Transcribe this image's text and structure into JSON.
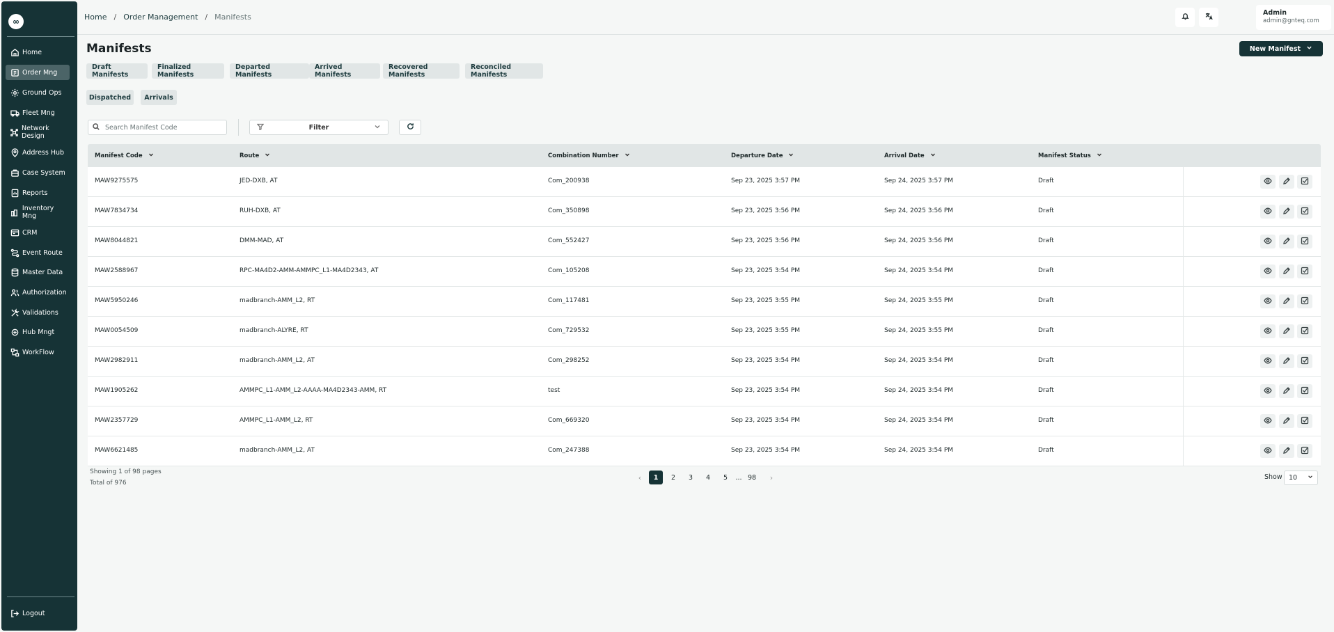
{
  "app": {
    "logo_glyph": "∞"
  },
  "sidebar": {
    "items": [
      {
        "label": "Home",
        "icon": "home-icon"
      },
      {
        "label": "Order Mng",
        "icon": "order-icon",
        "active": true
      },
      {
        "label": "Ground Ops",
        "icon": "ground-ops-icon"
      },
      {
        "label": "Fleet Mng",
        "icon": "truck-icon"
      },
      {
        "label": "Network Design",
        "icon": "network-icon"
      },
      {
        "label": "Address Hub",
        "icon": "location-icon"
      },
      {
        "label": "Case System",
        "icon": "case-icon"
      },
      {
        "label": "Reports",
        "icon": "reports-icon"
      },
      {
        "label": "Inventory Mng",
        "icon": "inventory-icon"
      },
      {
        "label": "CRM",
        "icon": "crm-icon"
      },
      {
        "label": "Event Route",
        "icon": "route-icon"
      },
      {
        "label": "Master Data",
        "icon": "database-icon"
      },
      {
        "label": "Authorization",
        "icon": "users-icon"
      },
      {
        "label": "Validations",
        "icon": "tools-icon"
      },
      {
        "label": "Hub Mngt",
        "icon": "hub-icon"
      },
      {
        "label": "WorkFlow",
        "icon": "workflow-icon"
      }
    ],
    "logout": "Logout"
  },
  "breadcrumb": {
    "home": "Home",
    "section": "Order Management",
    "current": "Manifests",
    "separator": "/"
  },
  "user": {
    "name": "Admin",
    "email": "admin@gnteq.com"
  },
  "page": {
    "title": "Manifests",
    "new_button": "New Manifest"
  },
  "tabs": [
    "Draft Manifests",
    "Finalized Manifests",
    "Departed Manifests",
    "Arrived Manifests",
    "Recovered Manifests",
    "Reconciled Manifests",
    "Dispatched",
    "Arrivals"
  ],
  "search": {
    "placeholder": "Search Manifest Code"
  },
  "filter": {
    "label": "Filter"
  },
  "table": {
    "columns": [
      "Manifest Code",
      "Route",
      "Combination Number",
      "Departure Date",
      "Arrival Date",
      "Manifest Status"
    ],
    "rows": [
      [
        "MAW9275575",
        "JED-DXB, AT",
        "Com_200938",
        "Sep 23, 2025 3:57 PM",
        "Sep 24, 2025 3:57 PM",
        "Draft"
      ],
      [
        "MAW7834734",
        "RUH-DXB, AT",
        "Com_350898",
        "Sep 23, 2025 3:56 PM",
        "Sep 24, 2025 3:56 PM",
        "Draft"
      ],
      [
        "MAW8044821",
        "DMM-MAD, AT",
        "Com_552427",
        "Sep 23, 2025 3:56 PM",
        "Sep 24, 2025 3:56 PM",
        "Draft"
      ],
      [
        "MAW2588967",
        "RPC-MA4D2-AMM-AMMPC_L1-MA4D2343, AT",
        "Com_105208",
        "Sep 23, 2025 3:54 PM",
        "Sep 24, 2025 3:54 PM",
        "Draft"
      ],
      [
        "MAW5950246",
        "madbranch-AMM_L2, RT",
        "Com_117481",
        "Sep 23, 2025 3:55 PM",
        "Sep 24, 2025 3:55 PM",
        "Draft"
      ],
      [
        "MAW0054509",
        "madbranch-ALYRE, RT",
        "Com_729532",
        "Sep 23, 2025 3:55 PM",
        "Sep 24, 2025 3:55 PM",
        "Draft"
      ],
      [
        "MAW2982911",
        "madbranch-AMM_L2, AT",
        "Com_298252",
        "Sep 23, 2025 3:54 PM",
        "Sep 24, 2025 3:54 PM",
        "Draft"
      ],
      [
        "MAW1905262",
        "AMMPC_L1-AMM_L2-AAAA-MA4D2343-AMM, RT",
        "test",
        "Sep 23, 2025 3:54 PM",
        "Sep 24, 2025 3:54 PM",
        "Draft"
      ],
      [
        "MAW2357729",
        "AMMPC_L1-AMM_L2, RT",
        "Com_669320",
        "Sep 23, 2025 3:54 PM",
        "Sep 24, 2025 3:54 PM",
        "Draft"
      ],
      [
        "MAW6621485",
        "madbranch-AMM_L2, AT",
        "Com_247388",
        "Sep 23, 2025 3:54 PM",
        "Sep 24, 2025 3:54 PM",
        "Draft"
      ]
    ],
    "row_actions": [
      "view-icon",
      "edit-icon",
      "approve-icon"
    ]
  },
  "pagination": {
    "showing": "Showing 1 of 98 pages",
    "total": "Total of 976",
    "pages": [
      "1",
      "2",
      "3",
      "4",
      "5",
      "...",
      "98"
    ],
    "current_page": "1",
    "prev": "‹",
    "next": "›",
    "show_label": "Show",
    "page_size": "10"
  },
  "colors": {
    "sidebar": "#163336",
    "accent": "#163336",
    "tab_bg": "#e1e6e6"
  }
}
